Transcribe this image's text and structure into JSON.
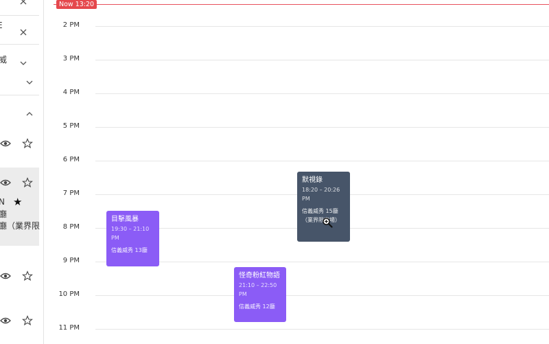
{
  "now_indicator": "Now 13:20",
  "hours": [
    "2 PM",
    "3 PM",
    "4 PM",
    "5 PM",
    "6 PM",
    "7 PM",
    "8 PM",
    "9 PM",
    "10 PM",
    "11 PM"
  ],
  "sidebar": {
    "text_fragments": [
      "E",
      "威",
      "N",
      "廳",
      "廳（業界限"
    ],
    "icons": [
      "close-icon",
      "close-icon",
      "chevron-down-icon",
      "chevron-down-icon",
      "chevron-up-icon",
      "eye-icon",
      "star-outline-icon",
      "eye-icon",
      "star-outline-icon",
      "star-solid-icon",
      "eye-icon",
      "star-outline-icon",
      "eye-icon",
      "star-outline-icon"
    ]
  },
  "events": [
    {
      "title": "目擊風暴",
      "time": "19:30 – 21:10 PM",
      "venue": "信義威秀 13廳",
      "color": "#8b5cf6"
    },
    {
      "title": "默視錄",
      "time": "18:20 – 20:26 PM",
      "venue": "信義威秀 15廳（業界限定場）",
      "color": "#475569"
    },
    {
      "title": "怪奇粉紅物語",
      "time": "21:10 – 22:50 PM",
      "venue": "信義威秀 12廳",
      "color": "#8b5cf6"
    }
  ],
  "colors": {
    "now_line": "#e8505b",
    "event_purple": "#8b5cf6",
    "event_slate": "#475569"
  }
}
